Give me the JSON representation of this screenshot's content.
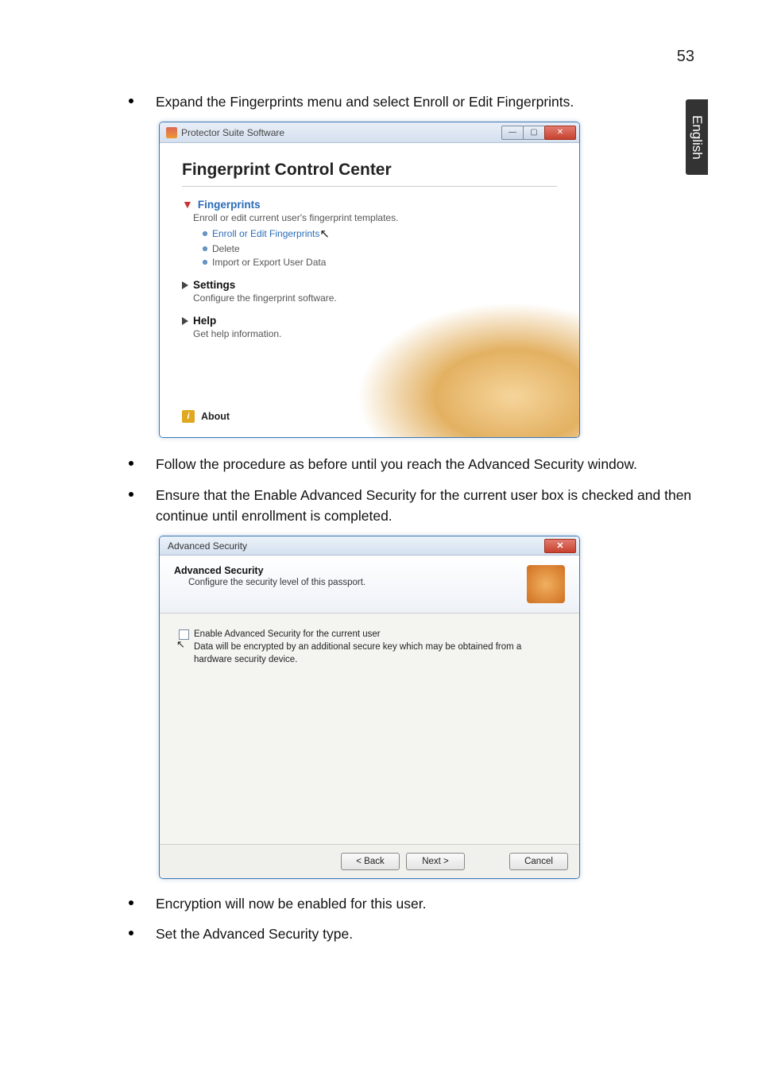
{
  "page_number": "53",
  "side_tab": "English",
  "bullets": {
    "b1": "Expand the Fingerprints menu and select Enroll or Edit Fingerprints.",
    "b2": "Follow the procedure as before until you reach the Advanced Security window.",
    "b3": "Ensure that the Enable Advanced Security for the current user box is checked and then continue until enrollment is completed.",
    "b4": "Encryption will now be enabled for this user.",
    "b5": "Set the Advanced Security type."
  },
  "window1": {
    "title": "Protector Suite Software",
    "heading": "Fingerprint Control Center",
    "fingerprints": {
      "label": "Fingerprints",
      "desc": "Enroll or edit current user's fingerprint templates.",
      "items": {
        "enroll": "Enroll or Edit Fingerprints",
        "delete": "Delete",
        "import": "Import or Export User Data"
      }
    },
    "settings": {
      "label": "Settings",
      "desc": "Configure the fingerprint software."
    },
    "help": {
      "label": "Help",
      "desc": "Get help information."
    },
    "about": "About"
  },
  "window2": {
    "title": "Advanced Security",
    "header_title": "Advanced Security",
    "header_desc": "Configure the security level of this passport.",
    "checkbox_label": "Enable Advanced Security for the current user",
    "body_desc": "Data will be encrypted by an additional secure key which may be obtained from a hardware security device.",
    "buttons": {
      "back": "< Back",
      "next": "Next >",
      "cancel": "Cancel"
    }
  }
}
